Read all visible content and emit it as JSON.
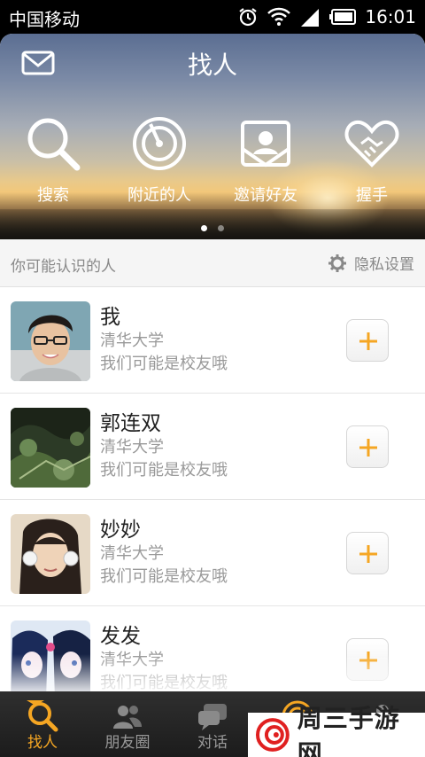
{
  "status_bar": {
    "carrier": "中国移动",
    "time": "16:01"
  },
  "header": {
    "title": "找人"
  },
  "features": [
    {
      "label": "搜索",
      "icon": "search-icon"
    },
    {
      "label": "附近的人",
      "icon": "radar-icon"
    },
    {
      "label": "邀请好友",
      "icon": "invite-card-icon"
    },
    {
      "label": "握手",
      "icon": "handshake-heart-icon"
    }
  ],
  "pager": {
    "pages": 2,
    "current": 1
  },
  "section": {
    "title": "你可能认识的人",
    "privacy_label": "隐私设置"
  },
  "people": [
    {
      "name": "我",
      "school": "清华大学",
      "note": "我们可能是校友哦"
    },
    {
      "name": "郭连双",
      "school": "清华大学",
      "note": "我们可能是校友哦"
    },
    {
      "name": "妙妙",
      "school": "清华大学",
      "note": "我们可能是校友哦"
    },
    {
      "name": "发发",
      "school": "清华大学",
      "note": "我们可能是校友哦"
    }
  ],
  "tabs": [
    {
      "label": "找人",
      "active": true
    },
    {
      "label": "朋友圈",
      "active": false
    },
    {
      "label": "对话",
      "active": false
    },
    {
      "label": "",
      "active": false
    },
    {
      "label": "",
      "active": false
    }
  ],
  "watermark": {
    "text": "周三手游网"
  },
  "colors": {
    "accent": "#f5a623",
    "tabbar": "#262626"
  }
}
